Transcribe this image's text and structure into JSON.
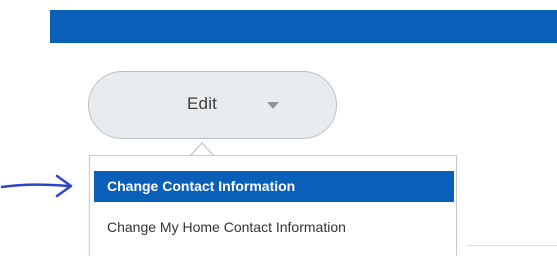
{
  "toolbar": {
    "edit_label": "Edit",
    "accent_color": "#0a5fb8"
  },
  "dropdown": {
    "items": [
      {
        "label": "Change Contact Information",
        "selected": true
      },
      {
        "label": "Change My Home Contact Information",
        "selected": false
      }
    ]
  },
  "annotation": {
    "icon": "hand-drawn-arrow-icon",
    "color": "#2d46c7"
  }
}
